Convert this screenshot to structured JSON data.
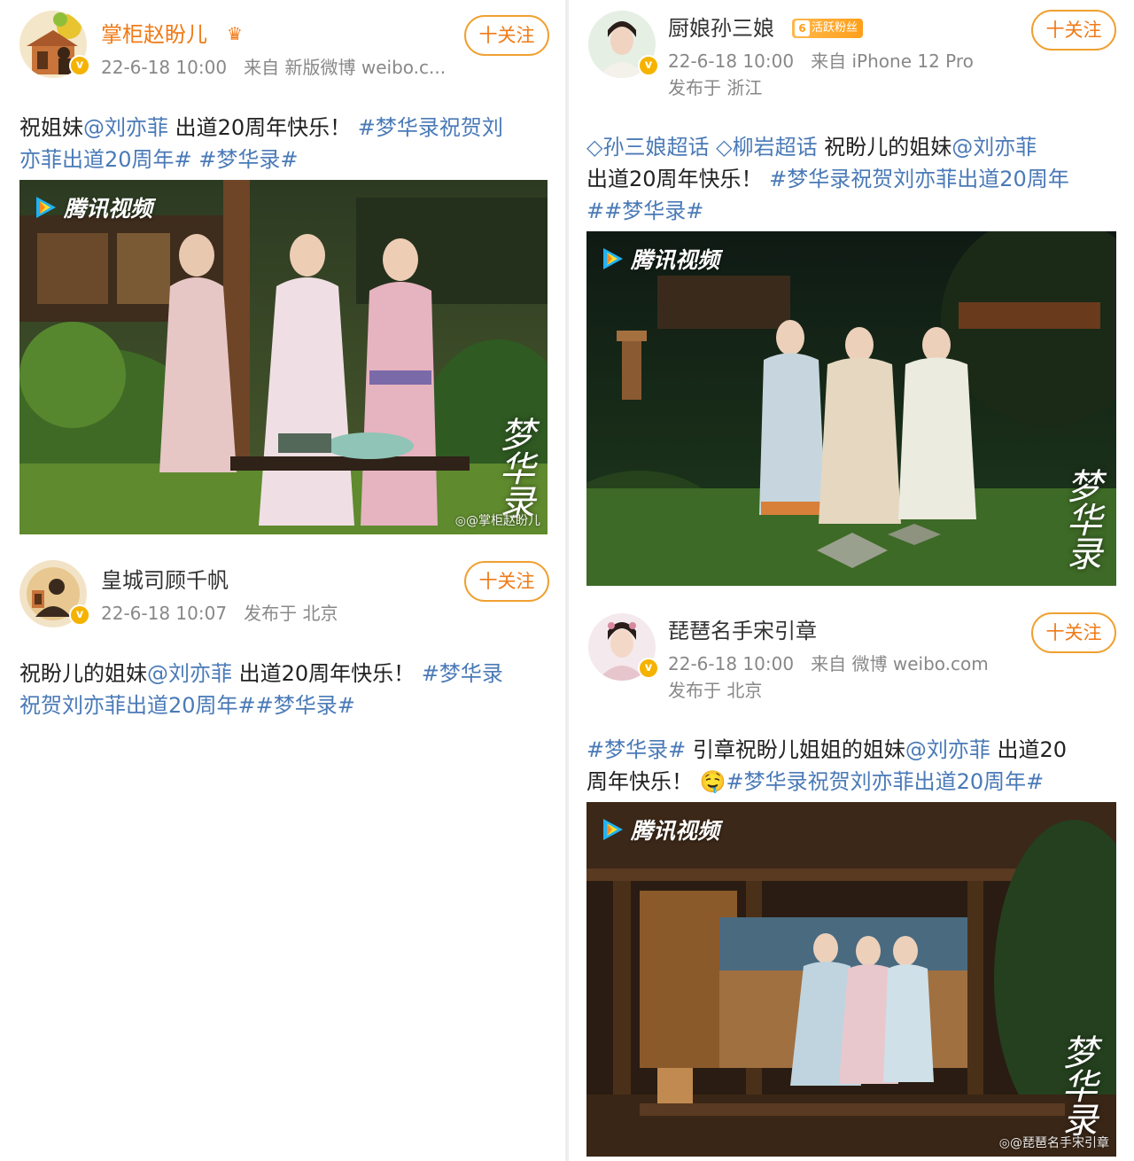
{
  "posts": [
    {
      "username": "掌柜赵盼儿",
      "verified_mark": "v",
      "crown_icon": "crown-icon",
      "time": "22-6-18 10:00",
      "source": "来自 新版微博 weibo.c...",
      "follow": "十关注",
      "content": {
        "p1": "祝姐妹",
        "mention": "@刘亦菲",
        "p2": " 出道20周年快乐！ ",
        "tag1": "#梦华录祝贺刘",
        "tag1b": "亦菲出道20周年#",
        "tag2": " #梦华录#"
      },
      "media": {
        "platform": "腾讯视频",
        "calligraphy": "梦华录",
        "watermark": "@掌柜赵盼儿"
      }
    },
    {
      "username": "皇城司顾千帆",
      "verified_mark": "v",
      "time": "22-6-18 10:07",
      "location": "发布于 北京",
      "follow": "十关注",
      "content": {
        "p1": "祝盼儿的姐妹",
        "mention": "@刘亦菲",
        "p2": " 出道20周年快乐！ ",
        "tag1": "#梦华录",
        "tag1b": "祝贺刘亦菲出道20周年##梦华录#"
      }
    },
    {
      "username": "厨娘孙三娘",
      "verified_mark": "v",
      "fan_badge": "活跃粉丝",
      "fan_level": "6",
      "time": "22-6-18 10:00",
      "source": "来自 iPhone 12 Pro",
      "location": "发布于 浙江",
      "follow": "十关注",
      "content": {
        "super1": "孙三娘超话",
        "super2": "柳岩超话",
        "p1": " 祝盼儿的姐妹",
        "mention": "@刘亦菲",
        "p2": "出道20周年快乐！ ",
        "tag1": "#梦华录祝贺刘亦菲出道20周年",
        "tag1b": "##梦华录#"
      },
      "media": {
        "platform": "腾讯视频",
        "calligraphy": "梦华录"
      }
    },
    {
      "username": "琵琶名手宋引章",
      "verified_mark": "v",
      "time": "22-6-18 10:00",
      "source": "来自 微博 weibo.com",
      "location": "发布于 北京",
      "follow": "十关注",
      "content": {
        "tag0": "#梦华录#",
        "p1": " 引章祝盼儿姐姐的姐妹",
        "mention": "@刘亦菲",
        "p2": " 出道20",
        "p3": "周年快乐！ ",
        "emoji": "🤤",
        "tag1": "#梦华录祝贺刘亦菲出道20周年#"
      },
      "media": {
        "platform": "腾讯视频",
        "calligraphy": "梦华录",
        "watermark": "@琵琶名手宋引章"
      }
    }
  ],
  "colors": {
    "vip_name": "#f07a16",
    "link": "#4a7ab7",
    "follow_border": "#f0a030",
    "verified": "#f5b300"
  }
}
